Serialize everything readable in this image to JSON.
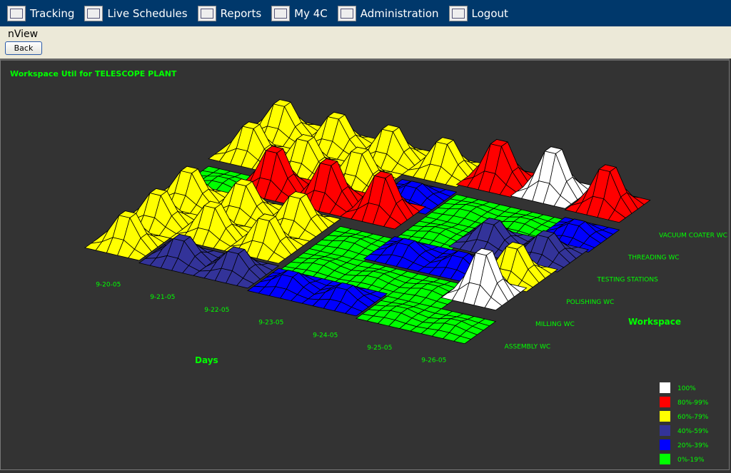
{
  "nav": [
    {
      "label": "Tracking",
      "icon": "tracking-chart-icon"
    },
    {
      "label": "Live Schedules",
      "icon": "calendar-icon"
    },
    {
      "label": "Reports",
      "icon": "reports-bars-icon"
    },
    {
      "label": "My 4C",
      "icon": "my4c-icon"
    },
    {
      "label": "Administration",
      "icon": "keyboard-icon"
    },
    {
      "label": "Logout",
      "icon": "logout-door-icon"
    }
  ],
  "page": {
    "title": "nView",
    "back_label": "Back"
  },
  "chart_data": {
    "type": "surface3d",
    "title": "Workspace Util for TELESCOPE PLANT",
    "xlabel": "Days",
    "ylabel": "Workspace",
    "days": [
      "9-20-05",
      "9-21-05",
      "9-22-05",
      "9-23-05",
      "9-24-05",
      "9-25-05",
      "9-26-05"
    ],
    "workspaces": [
      "ASSEMBLY WC",
      "MILLING WC",
      "POLISHING WC",
      "TESTING STATIONS",
      "THREADING WC",
      "VACUUM COATER WC"
    ],
    "utilization": [
      [
        70,
        50,
        50,
        30,
        30,
        10,
        10
      ],
      [
        70,
        70,
        70,
        10,
        10,
        10,
        100
      ],
      [
        70,
        70,
        70,
        10,
        30,
        30,
        70
      ],
      [
        10,
        90,
        90,
        90,
        10,
        50,
        50
      ],
      [
        70,
        70,
        70,
        30,
        10,
        10,
        30
      ],
      [
        70,
        70,
        70,
        70,
        90,
        100,
        90
      ]
    ],
    "legend": [
      {
        "label": "100%",
        "color": "#ffffff",
        "min": 100
      },
      {
        "label": "80%-99%",
        "color": "#ff0000",
        "min": 80
      },
      {
        "label": "60%-79%",
        "color": "#ffff00",
        "min": 60
      },
      {
        "label": "40%-59%",
        "color": "#333399",
        "min": 40
      },
      {
        "label": "20%-39%",
        "color": "#0000ff",
        "min": 20
      },
      {
        "label": "0%-19%",
        "color": "#00ff00",
        "min": 0
      }
    ]
  }
}
